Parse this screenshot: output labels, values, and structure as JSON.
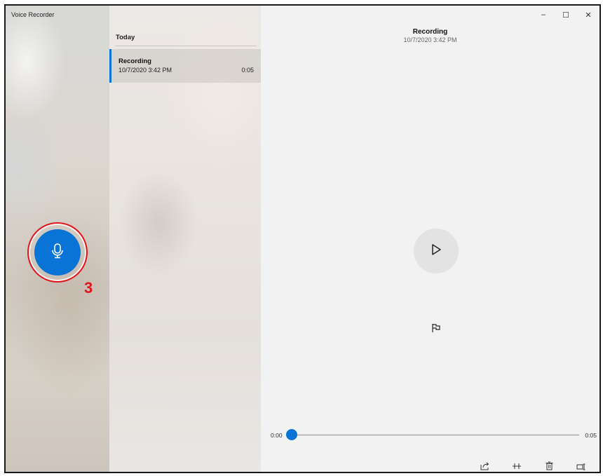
{
  "app": {
    "title": "Voice Recorder"
  },
  "window_controls": {
    "minimize": "–",
    "maximize": "☐",
    "close": "✕"
  },
  "list": {
    "group_header": "Today",
    "items": [
      {
        "name": "Recording",
        "date": "10/7/2020 3:42 PM",
        "duration": "0:05"
      }
    ]
  },
  "detail": {
    "title": "Recording",
    "date": "10/7/2020 3:42 PM",
    "time_start": "0:00",
    "time_end": "0:05",
    "progress_fraction": 0.0
  },
  "icons": {
    "record": "microphone-icon",
    "play": "play-icon",
    "flag": "flag-icon",
    "share": "share-icon",
    "trim": "trim-icon",
    "delete": "delete-icon",
    "rename": "rename-icon",
    "more": "more-icon"
  },
  "annotation": {
    "number": "3",
    "color": "#e3141b"
  },
  "colors": {
    "accent": "#0a74d6"
  }
}
